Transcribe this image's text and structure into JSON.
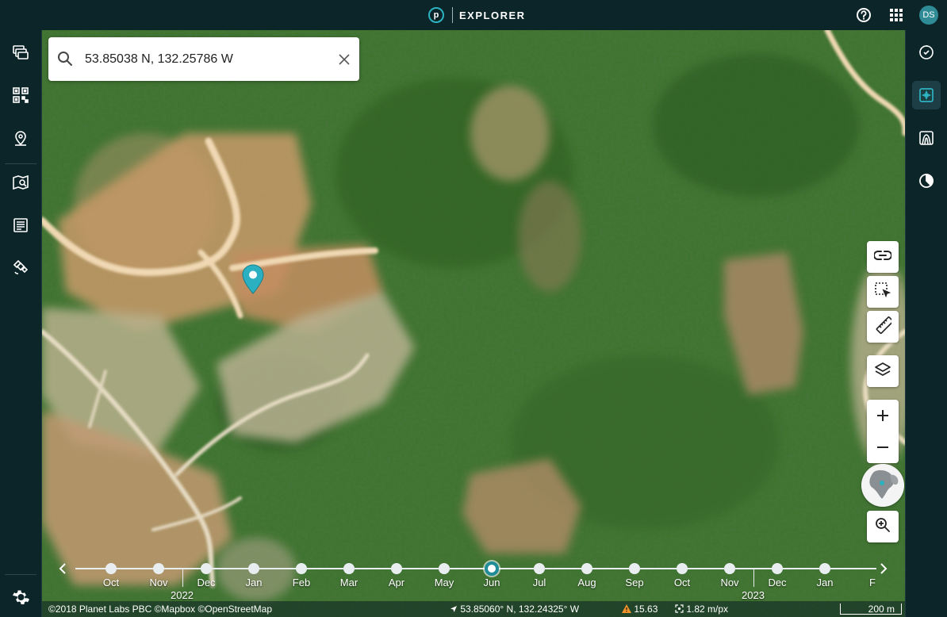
{
  "app": {
    "brand_letter": "p",
    "title": "EXPLORER",
    "user_initials": "DS"
  },
  "search": {
    "value": "53.85038 N, 132.25786 W"
  },
  "left_sidebar": [
    "layers-stack-icon",
    "mosaic-grid-icon",
    "places-pin-icon",
    "map-explore-icon",
    "notes-list-icon",
    "satellite-icon",
    "settings-gear-icon"
  ],
  "right_sidebar": [
    "compare-icon",
    "analytics-icon",
    "elevation-icon",
    "time-lapse-icon"
  ],
  "timeline": {
    "months": [
      "Oct",
      "Nov",
      "Dec",
      "Jan",
      "Feb",
      "Mar",
      "Apr",
      "May",
      "Jun",
      "Jul",
      "Aug",
      "Sep",
      "Oct",
      "Nov",
      "Dec",
      "Jan",
      "F"
    ],
    "selected_index": 8,
    "years": [
      {
        "label": "2022",
        "after_index": 1
      },
      {
        "label": "2023",
        "after_index": 13
      }
    ]
  },
  "footer": {
    "attribution": "©2018 Planet Labs PBC ©Mapbox ©OpenStreetMap",
    "cursor_coords": "53.85060° N, 132.24325° W",
    "warning_value": "15.63",
    "resolution": "1.82 m/px",
    "scale_label": "200 m"
  },
  "colors": {
    "accent": "#1f8c98",
    "warning": "#f0932b"
  }
}
